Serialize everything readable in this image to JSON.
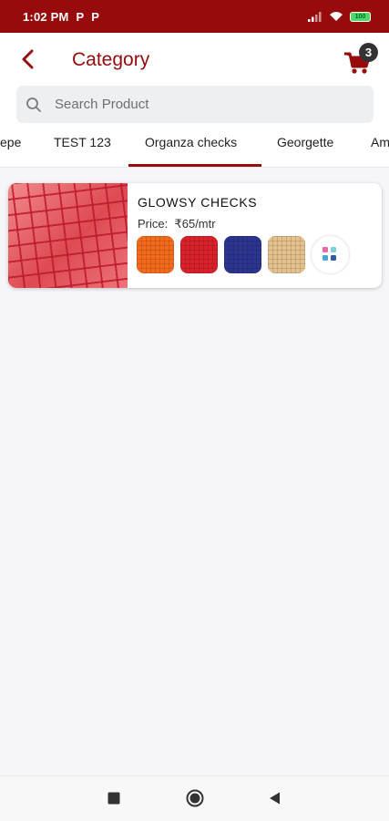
{
  "status_bar": {
    "time": "1:02 PM",
    "notification_icons": [
      "P",
      "P"
    ],
    "battery": "100"
  },
  "header": {
    "title": "Category",
    "cart_count": "3"
  },
  "search": {
    "placeholder": "Search Product"
  },
  "tabs": [
    {
      "label": "epe"
    },
    {
      "label": "TEST 123"
    },
    {
      "label": "Organza checks",
      "selected": true
    },
    {
      "label": "Georgette"
    },
    {
      "label": "Am"
    }
  ],
  "products": [
    {
      "name": "GLOWSY CHECKS",
      "price_label": "Price:",
      "price": "₹65/mtr",
      "swatches": [
        "#f26a1b",
        "#d8212a",
        "#2b3590",
        "#e3c08c"
      ]
    }
  ],
  "colors": {
    "accent": "#970b0d",
    "background": "#f6f6f8"
  }
}
